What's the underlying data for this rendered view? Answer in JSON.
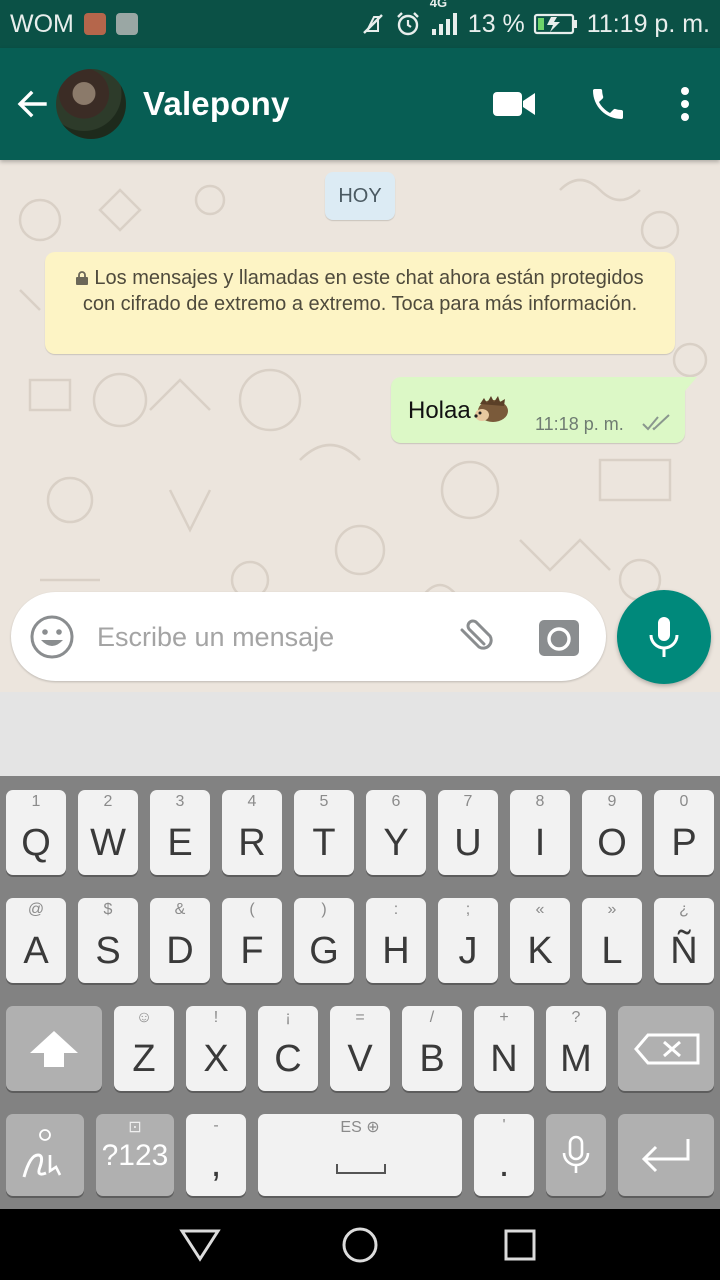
{
  "status_bar": {
    "carrier": "WOM",
    "network": "4G",
    "battery": "13 %",
    "time": "11:19 p. m."
  },
  "header": {
    "contact_name": "Valepony"
  },
  "chat": {
    "date_chip": "HOY",
    "encryption_notice": "Los mensajes y llamadas en este chat ahora están protegidos con cifrado de extremo a extremo. Toca para más información.",
    "messages": [
      {
        "text": "Holaa",
        "time": "11:18 p. m.",
        "status": "read"
      }
    ]
  },
  "composer": {
    "placeholder": "Escribe un mensaje",
    "value": ""
  },
  "keyboard": {
    "row1": [
      {
        "main": "Q",
        "hint": "1"
      },
      {
        "main": "W",
        "hint": "2"
      },
      {
        "main": "E",
        "hint": "3"
      },
      {
        "main": "R",
        "hint": "4"
      },
      {
        "main": "T",
        "hint": "5"
      },
      {
        "main": "Y",
        "hint": "6"
      },
      {
        "main": "U",
        "hint": "7"
      },
      {
        "main": "I",
        "hint": "8"
      },
      {
        "main": "O",
        "hint": "9"
      },
      {
        "main": "P",
        "hint": "0"
      }
    ],
    "row2": [
      {
        "main": "A",
        "hint": "@"
      },
      {
        "main": "S",
        "hint": "$"
      },
      {
        "main": "D",
        "hint": "&"
      },
      {
        "main": "F",
        "hint": "("
      },
      {
        "main": "G",
        "hint": ")"
      },
      {
        "main": "H",
        "hint": ":"
      },
      {
        "main": "J",
        "hint": ";"
      },
      {
        "main": "K",
        "hint": "«"
      },
      {
        "main": "L",
        "hint": "»"
      },
      {
        "main": "Ñ",
        "hint": "¿"
      }
    ],
    "row3": [
      {
        "main": "Z",
        "hint": "☺"
      },
      {
        "main": "X",
        "hint": "!"
      },
      {
        "main": "C",
        "hint": "¡"
      },
      {
        "main": "V",
        "hint": "="
      },
      {
        "main": "B",
        "hint": "/"
      },
      {
        "main": "N",
        "hint": "+"
      },
      {
        "main": "M",
        "hint": "?"
      }
    ],
    "symbols_label": "?123",
    "comma": {
      "main": ",",
      "hint": "-"
    },
    "space_label": "ES",
    "period": {
      "main": ".",
      "hint": "'"
    }
  },
  "colors": {
    "header": "#075e54",
    "status_bar": "#0b5146",
    "accent_fab": "#00897b",
    "outgoing_bubble": "#dcf8c6",
    "notice_bubble": "#fdf4c5",
    "date_chip": "#dcebf4"
  }
}
